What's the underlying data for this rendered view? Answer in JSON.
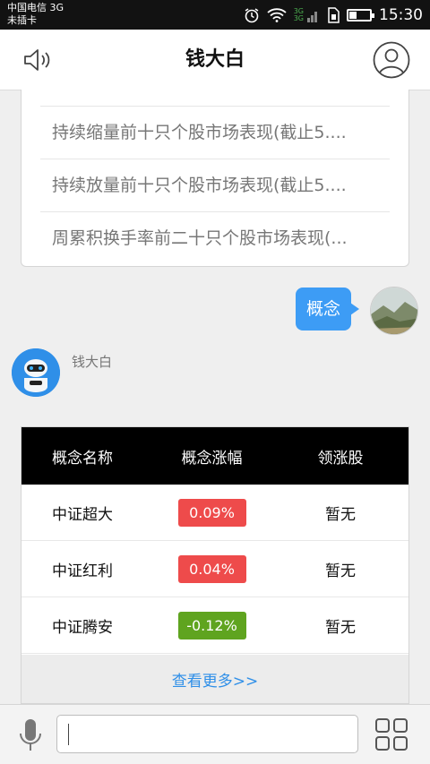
{
  "status_bar": {
    "carrier": "中国电信 3G",
    "sim": "未插卡",
    "network": "3G",
    "network2": "3G",
    "time": "15:30",
    "battery_level": 0.35
  },
  "header": {
    "title": "钱大白"
  },
  "related": [
    "持续缩量前十只个股市场表现(截止5....",
    "持续放量前十只个股市场表现(截止5....",
    "周累积换手率前二十只个股市场表现(..."
  ],
  "user_message": "概念",
  "bot": {
    "name": "钱大白"
  },
  "concept_table": {
    "headers": [
      "概念名称",
      "概念涨幅",
      "领涨股"
    ],
    "rows": [
      {
        "name": "中证超大",
        "change": "0.09%",
        "color": "#ee4b4b",
        "leader": "暂无"
      },
      {
        "name": "中证红利",
        "change": "0.04%",
        "color": "#ee4b4b",
        "leader": "暂无"
      },
      {
        "name": "中证腾安",
        "change": "-0.12%",
        "color": "#5fa41f",
        "leader": "暂无"
      }
    ],
    "more": "查看更多>>"
  },
  "colors": {
    "accent": "#3d9cf5",
    "up": "#ee4b4b",
    "down": "#5fa41f"
  }
}
